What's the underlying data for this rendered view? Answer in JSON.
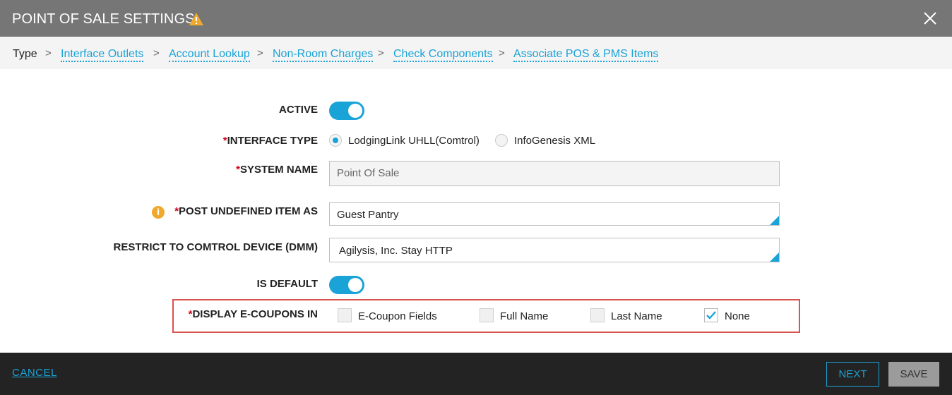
{
  "header": {
    "title": "POINT OF SALE SETTINGS",
    "warning_icon": "warning-triangle-icon",
    "close_icon": "close-icon"
  },
  "breadcrumb": {
    "items": [
      {
        "label": "Type",
        "current": true
      },
      {
        "label": "Interface Outlets",
        "current": false
      },
      {
        "label": "Account Lookup",
        "current": false
      },
      {
        "label": "Non-Room Charges",
        "current": false
      },
      {
        "label": "Check Components",
        "current": false
      },
      {
        "label": "Associate POS & PMS Items",
        "current": false
      }
    ],
    "separator": ">"
  },
  "form": {
    "required_mark": "*",
    "active": {
      "label": "ACTIVE",
      "value": true
    },
    "interface_type": {
      "label": "INTERFACE TYPE",
      "options": [
        {
          "label": "LodgingLink UHLL(Comtrol)",
          "selected": true
        },
        {
          "label": "InfoGenesis XML",
          "selected": false
        }
      ]
    },
    "system_name": {
      "label": "SYSTEM NAME",
      "placeholder": "Point Of Sale"
    },
    "post_undefined": {
      "label": "POST UNDEFINED ITEM AS",
      "value": "Guest Pantry",
      "icon": "info-icon"
    },
    "restrict_device": {
      "label": "RESTRICT TO COMTROL DEVICE (DMM)",
      "value": "Agilysis, Inc. Stay HTTP"
    },
    "is_default": {
      "label": "IS DEFAULT",
      "value": true
    },
    "display_ecoupons": {
      "label": "DISPLAY E-COUPONS IN",
      "options": [
        {
          "label": "E-Coupon Fields",
          "checked": false
        },
        {
          "label": "Full Name",
          "checked": false
        },
        {
          "label": "Last Name",
          "checked": false
        },
        {
          "label": "None",
          "checked": true
        }
      ]
    }
  },
  "footer": {
    "cancel_label": "CANCEL",
    "next_label": "NEXT",
    "save_label": "SAVE"
  },
  "colors": {
    "accent": "#1aa3d6",
    "header_bg": "#767676",
    "footer_bg": "#232323",
    "highlight": "#d9534f",
    "required": "#d0021b",
    "warning": "#f0a92d"
  }
}
